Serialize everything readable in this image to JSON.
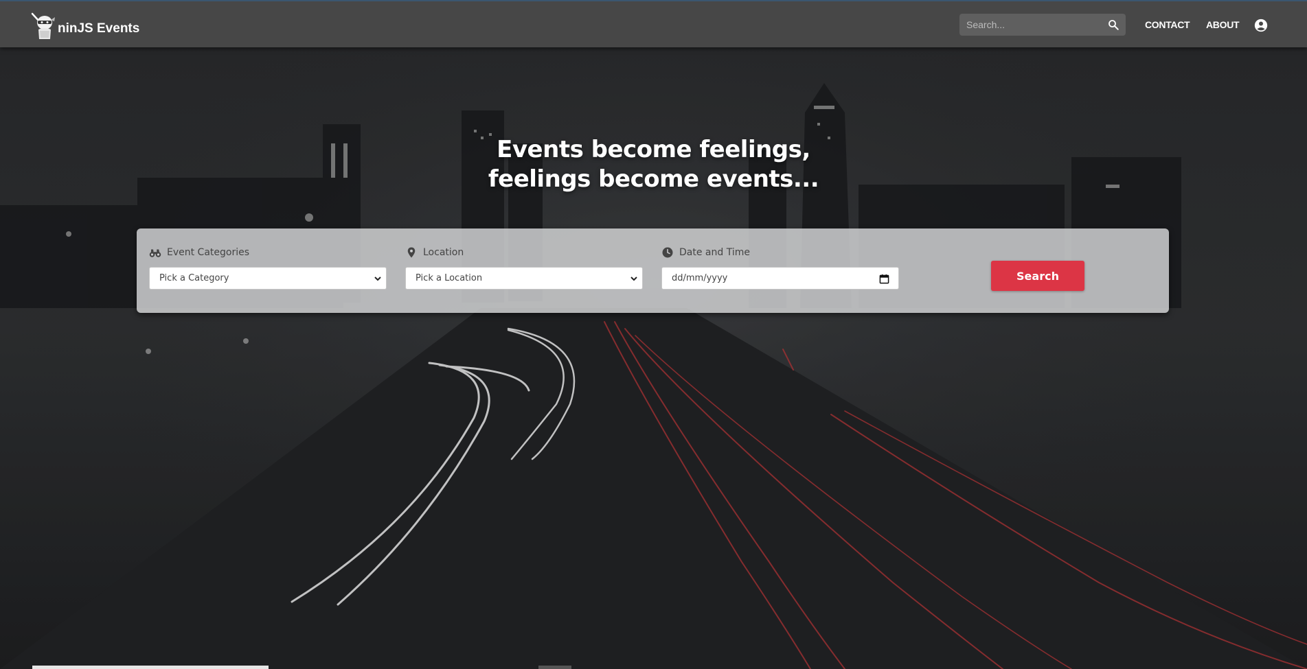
{
  "brand": {
    "name": "ninJS Events",
    "logo_icon": "ninja-logo-icon"
  },
  "nav": {
    "search_placeholder": "Search...",
    "search_icon": "search-icon",
    "links": [
      {
        "label": "CONTACT"
      },
      {
        "label": "ABOUT"
      }
    ],
    "account_icon": "account-circle-icon"
  },
  "hero": {
    "headline_line1": "Events become feelings,",
    "headline_line2": "feelings become events..."
  },
  "search_panel": {
    "category": {
      "label": "Event Categories",
      "icon": "binoculars-icon",
      "value": "Pick a Category"
    },
    "location": {
      "label": "Location",
      "icon": "map-pin-icon",
      "value": "Pick a Location"
    },
    "datetime": {
      "label": "Date and Time",
      "icon": "clock-icon",
      "placeholder": "dd/mm/yyyy"
    },
    "submit_label": "Search"
  },
  "colors": {
    "navbar": "#474747",
    "accent_button": "#dc3545",
    "panel": "#cecfd1",
    "background": "#262729"
  }
}
